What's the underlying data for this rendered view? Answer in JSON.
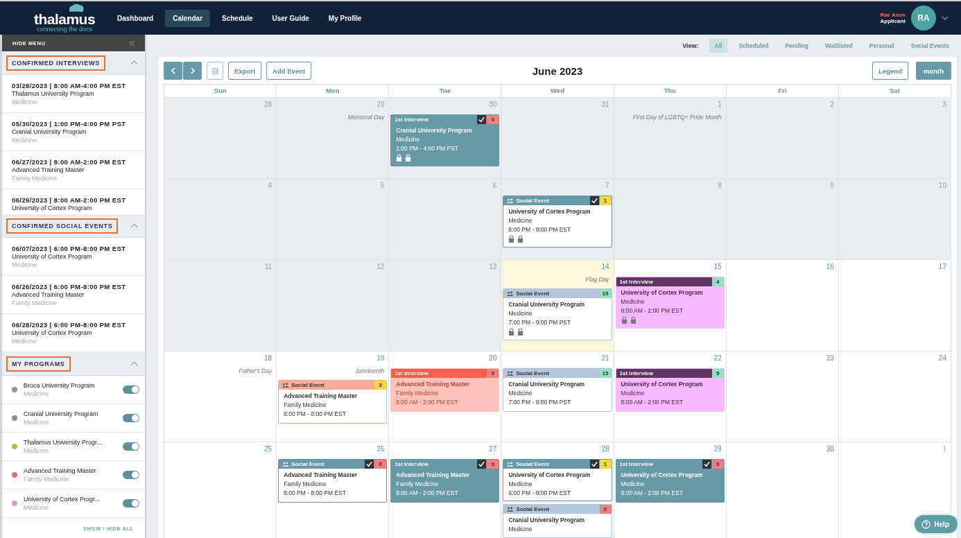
{
  "brand": {
    "name": "thalamus",
    "tagline": "connecting the docs"
  },
  "nav": [
    {
      "label": "Dashboard",
      "selected": false
    },
    {
      "label": "Calendar",
      "selected": true
    },
    {
      "label": "Schedule",
      "selected": false
    },
    {
      "label": "User Guide",
      "selected": false
    },
    {
      "label": "My Profile",
      "selected": false
    }
  ],
  "user": {
    "name": "Rae Axon",
    "role": "Applicant",
    "initials": "RA"
  },
  "sidebar": {
    "hide_label": "HIDE MENU",
    "sections": [
      {
        "title": "CONFIRMED INTERVIEWS",
        "expanded": true,
        "items": [
          {
            "date": "03/28/2023 | 8:00 AM-4:00 PM EST",
            "name": "Thalamus University Program",
            "sub": "Medicine"
          },
          {
            "date": "05/30/2023 | 1:00 PM-4:00 PM PST",
            "name": "Cranial University Program",
            "sub": "Medicine"
          },
          {
            "date": "06/27/2023 | 8:00 AM-2:00 PM EST",
            "name": "Advanced Training Master",
            "sub": "Family Medicine"
          },
          {
            "date": "06/29/2023 | 8:00 AM-2:00 PM EST",
            "name": "University of Cortex Program"
          }
        ]
      },
      {
        "title": "CONFIRMED SOCIAL EVENTS",
        "expanded": true,
        "items": [
          {
            "date": "06/07/2023 | 6:00 PM-8:00 PM EST",
            "name": "University of Cortex Program",
            "sub": "Medicine"
          },
          {
            "date": "06/26/2023 | 6:00 PM-8:00 PM EST",
            "name": "Advanced Training Master",
            "sub": "Family Medicine"
          },
          {
            "date": "06/28/2023 | 6:00 PM-8:00 PM EST",
            "name": "University of Cortex Program",
            "sub": "Medicine"
          }
        ]
      }
    ],
    "programs": {
      "title": "MY PROGRAMS",
      "expanded": true,
      "items": [
        {
          "name": "Broca University Program",
          "sub": "Medicine",
          "color": "#a98aa8",
          "on": true
        },
        {
          "name": "Cranial University Program",
          "sub": "Medicine",
          "color": "#7d8fab",
          "on": true
        },
        {
          "name": "Thalamus University Progr...",
          "sub": "Medicine",
          "color": "#c3b650",
          "on": true
        },
        {
          "name": "Advanced Training Master",
          "sub": "Family Medicine",
          "color": "#d9756a",
          "on": true
        },
        {
          "name": "University of Cortex Progr...",
          "sub": "Medicine",
          "color": "#d79ad8",
          "on": true
        }
      ],
      "show_hide": "SHOW / HIDE ALL"
    }
  },
  "filters": {
    "label": "View:",
    "options": [
      {
        "label": "All",
        "selected": true
      },
      {
        "label": "Scheduled",
        "selected": false
      },
      {
        "label": "Pending",
        "selected": false
      },
      {
        "label": "Waitlisted",
        "selected": false
      },
      {
        "label": "Personal",
        "selected": false
      },
      {
        "label": "Social Events",
        "selected": false
      }
    ]
  },
  "toolbar": {
    "export": "Export",
    "add_event": "Add Event",
    "title": "June 2023",
    "legend": "Legend",
    "view": "month"
  },
  "weekdays": [
    "Sun",
    "Mon",
    "Tue",
    "Wed",
    "Thu",
    "Fri",
    "Sat"
  ],
  "weeks": [
    [
      {
        "date": "28",
        "kind": "past"
      },
      {
        "date": "29",
        "kind": "past",
        "holiday": "Memorial Day"
      },
      {
        "date": "30",
        "kind": "past",
        "events": [
          {
            "kind": "interview",
            "label": "1st Interview",
            "color": "#6899a7",
            "checked": true,
            "badge": {
              "text": "0",
              "color": "#f08080"
            },
            "name": "Cranial University Program",
            "sub": "Medicine",
            "time": "1:00 PM - 4:00 PM PST",
            "locks": true
          }
        ]
      },
      {
        "date": "31",
        "kind": "past"
      },
      {
        "date": "1",
        "kind": "past",
        "holiday": "First Day of LGBTQ+ Pride Month"
      },
      {
        "date": "2",
        "kind": "past"
      },
      {
        "date": "3",
        "kind": "past"
      }
    ],
    [
      {
        "date": "4",
        "kind": "past"
      },
      {
        "date": "5",
        "kind": "past"
      },
      {
        "date": "6",
        "kind": "past"
      },
      {
        "date": "7",
        "kind": "past",
        "events": [
          {
            "kind": "social",
            "label": "Social Event",
            "color": "#6899a7",
            "checked": true,
            "badge": {
              "text": "1",
              "color": "#f5d54a"
            },
            "name": "University of Cortex Program",
            "sub": "Medicine",
            "time": "6:00 PM - 8:00 PM EST",
            "locks": true
          }
        ]
      },
      {
        "date": "8",
        "kind": "past"
      },
      {
        "date": "9",
        "kind": "past"
      },
      {
        "date": "10",
        "kind": "past"
      }
    ],
    [
      {
        "date": "11",
        "kind": "past"
      },
      {
        "date": "12",
        "kind": "past"
      },
      {
        "date": "13",
        "kind": "past"
      },
      {
        "date": "14",
        "kind": "today",
        "holiday": "Flag Day",
        "events": [
          {
            "kind": "social",
            "label": "Social Event",
            "color": "#b3c4db",
            "checked": false,
            "badge": {
              "text": "15",
              "color": "#8fe2c2"
            },
            "name": "Cranial University Program",
            "sub": "Medicine",
            "time": "7:00 PM - 9:00 PM PST",
            "locks": true
          }
        ]
      },
      {
        "date": "15",
        "kind": "future",
        "events": [
          {
            "kind": "interview",
            "label": "1st Interview",
            "color": "#5e3462",
            "checked": false,
            "badge": {
              "text": "4",
              "color": "#8fe2c2"
            },
            "name": "University of Cortex Program",
            "sub": "Medicine",
            "time": "8:00 AM - 2:00 PM EST",
            "locks": true
          }
        ]
      },
      {
        "date": "16",
        "kind": "future"
      },
      {
        "date": "17",
        "kind": "future"
      }
    ],
    [
      {
        "date": "18",
        "kind": "future",
        "holiday": "Father's Day"
      },
      {
        "date": "19",
        "kind": "future",
        "holiday": "Juneteenth",
        "events": [
          {
            "kind": "social",
            "label": "Social Event",
            "color": "#f9ab98",
            "checked": false,
            "badge": {
              "text": "3",
              "color": "#f5d54a"
            },
            "name": "Advanced Training Master",
            "sub": "Family Medicine",
            "time": "6:00 PM - 8:00 PM EST",
            "locks": false
          }
        ]
      },
      {
        "date": "20",
        "kind": "future",
        "events": [
          {
            "kind": "interview",
            "label": "1st Interview",
            "color": "#f4604a",
            "checked": false,
            "badge": {
              "text": "0",
              "color": "#f08080"
            },
            "name": "Advanced Training Master",
            "sub": "Family Medicine",
            "time": "8:00 AM - 2:00 PM EST",
            "locks": false
          }
        ]
      },
      {
        "date": "21",
        "kind": "future",
        "events": [
          {
            "kind": "social",
            "label": "Social Event",
            "color": "#b3c4db",
            "checked": false,
            "badge": {
              "text": "15",
              "color": "#8fe2c2"
            },
            "name": "Cranial University Program",
            "sub": "Medicine",
            "time": "7:00 PM - 9:00 PM PST",
            "locks": false
          }
        ]
      },
      {
        "date": "22",
        "kind": "future",
        "events": [
          {
            "kind": "interview",
            "label": "1st Interview",
            "color": "#5e3462",
            "checked": false,
            "badge": {
              "text": "5",
              "color": "#8fe2c2"
            },
            "name": "University of Cortex Program",
            "sub": "Medicine",
            "time": "8:00 AM - 2:00 PM EST",
            "locks": false
          }
        ]
      },
      {
        "date": "23",
        "kind": "future"
      },
      {
        "date": "24",
        "kind": "future"
      }
    ],
    [
      {
        "date": "25",
        "kind": "future"
      },
      {
        "date": "26",
        "kind": "future",
        "events": [
          {
            "kind": "social",
            "label": "Social Event",
            "color": "#6899a7",
            "checked": true,
            "badge": {
              "text": "0",
              "color": "#f08080"
            },
            "name": "Advanced Training Master",
            "sub": "Family Medicine",
            "time": "6:00 PM - 8:00 PM EST",
            "locks": false
          }
        ]
      },
      {
        "date": "27",
        "kind": "future",
        "events": [
          {
            "kind": "interview",
            "label": "1st Interview",
            "color": "#6899a7",
            "checked": true,
            "badge": {
              "text": "0",
              "color": "#f08080"
            },
            "name": "Advanced Training Master",
            "sub": "Family Medicine",
            "time": "8:00 AM - 2:00 PM EST",
            "locks": false
          }
        ]
      },
      {
        "date": "28",
        "kind": "future",
        "events": [
          {
            "kind": "social",
            "label": "Social Event",
            "color": "#6899a7",
            "checked": true,
            "badge": {
              "text": "1",
              "color": "#f5d54a"
            },
            "name": "University of Cortex Program",
            "sub": "Medicine",
            "time": "6:00 PM - 8:00 PM EST",
            "locks": false
          },
          {
            "kind": "social",
            "label": "Social Event",
            "color": "#b3c4db",
            "checked": false,
            "badge": {
              "text": "0",
              "color": "#f08080"
            },
            "name": "Cranial University Program",
            "sub": "Medicine",
            "locks": false
          }
        ]
      },
      {
        "date": "29",
        "kind": "future",
        "events": [
          {
            "kind": "interview",
            "label": "1st Interview",
            "color": "#6899a7",
            "checked": true,
            "badge": {
              "text": "0",
              "color": "#f08080"
            },
            "name": "University of Cortex Program",
            "sub": "Medicine",
            "time": "8:00 AM - 2:00 PM EST",
            "locks": false
          }
        ]
      },
      {
        "date": "30",
        "kind": "future"
      },
      {
        "date": "1",
        "kind": "other"
      }
    ]
  ],
  "help": "Help"
}
